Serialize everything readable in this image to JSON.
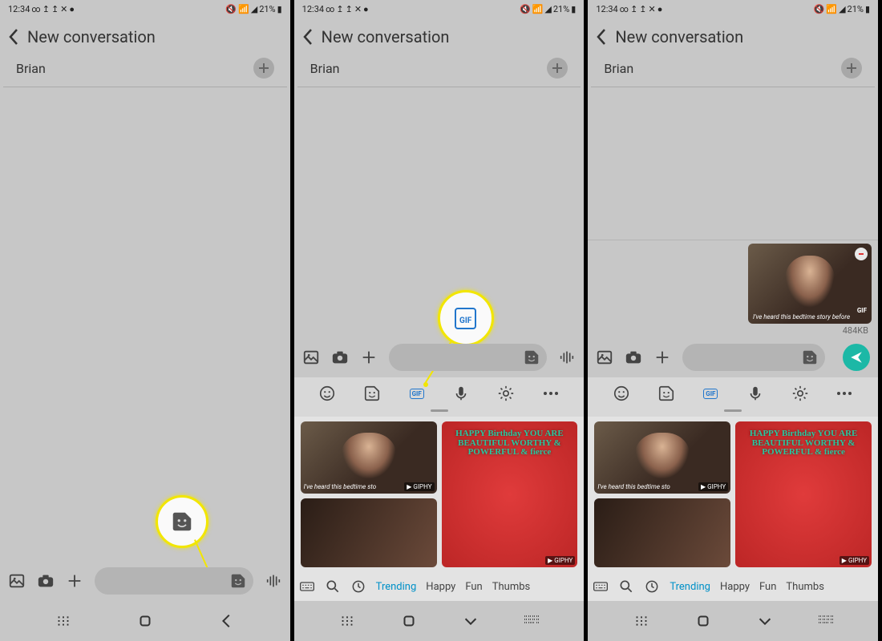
{
  "status": {
    "time": "12:34",
    "battery": "21%"
  },
  "header": {
    "title": "New conversation"
  },
  "recipient": {
    "name": "Brian"
  },
  "attachment": {
    "size_label": "484KB",
    "caption": "I've heard this bedtime story before",
    "gif_badge": "GIF"
  },
  "gifs": {
    "g1_caption": "I've heard this bedtime sto",
    "giphy": "GIPHY"
  },
  "bday_text": "HAPPY Birthday YOU ARE BEAUTIFUL WORTHY & POWERFUL & fierce",
  "categories": {
    "trending": "Trending",
    "happy": "Happy",
    "fun": "Fun",
    "thumbs": "Thumbs"
  },
  "gif_label": "GIF"
}
